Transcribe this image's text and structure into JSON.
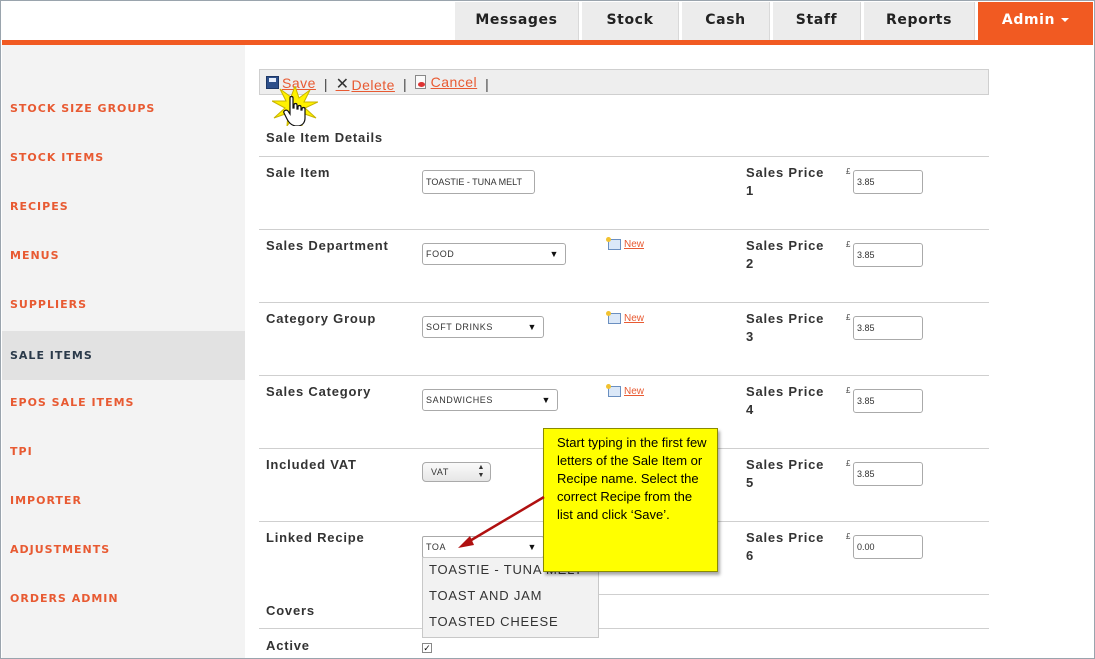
{
  "nav": {
    "tabs": [
      {
        "label": "Messages"
      },
      {
        "label": "Stock"
      },
      {
        "label": "Cash"
      },
      {
        "label": "Staff"
      },
      {
        "label": "Reports"
      },
      {
        "label": "Admin"
      }
    ],
    "active_color": "#f15a22"
  },
  "sidebar": {
    "items": [
      {
        "label": "STOCK SIZE GROUPS"
      },
      {
        "label": "STOCK ITEMS"
      },
      {
        "label": "RECIPES"
      },
      {
        "label": "MENUS"
      },
      {
        "label": "SUPPLIERS"
      },
      {
        "label": "SALE ITEMS"
      },
      {
        "label": "EPOS SALE ITEMS"
      },
      {
        "label": "TPI"
      },
      {
        "label": "IMPORTER"
      },
      {
        "label": "ADJUSTMENTS"
      },
      {
        "label": "ORDERS ADMIN"
      }
    ],
    "active_item": "SALE ITEMS"
  },
  "toolbar": {
    "save_label": "Save",
    "delete_label": "Delete",
    "cancel_label": "Cancel",
    "separator": "|"
  },
  "form": {
    "section_title": "Sale Item Details",
    "sale_item": {
      "label": "Sale Item",
      "value": "TOASTIE - TUNA MELT"
    },
    "sales_department": {
      "label": "Sales Department",
      "value": "FOOD",
      "new_label": "New"
    },
    "category_group": {
      "label": "Category Group",
      "value": "SOFT DRINKS",
      "new_label": "New"
    },
    "sales_category": {
      "label": "Sales Category",
      "value": "SANDWICHES",
      "new_label": "New"
    },
    "included_vat": {
      "label": "Included VAT",
      "value": "VAT"
    },
    "linked_recipe": {
      "label": "Linked Recipe",
      "value": "TOA",
      "options": [
        "TOASTIE - TUNA MELT",
        "TOAST AND JAM",
        "TOASTED CHEESE"
      ]
    },
    "covers": {
      "label": "Covers"
    },
    "active": {
      "label": "Active",
      "checked": true,
      "check_mark": "✓"
    },
    "currency_symbol": "£",
    "prices": [
      {
        "label": "Sales Price 1",
        "value": "3.85"
      },
      {
        "label": "Sales Price 2",
        "value": "3.85"
      },
      {
        "label": "Sales Price 3",
        "value": "3.85"
      },
      {
        "label": "Sales Price 4",
        "value": "3.85"
      },
      {
        "label": "Sales Price 5",
        "value": "3.85"
      },
      {
        "label": "Sales Price 6",
        "value": "0.00"
      }
    ]
  },
  "callout": {
    "text": "Start typing in the first few letters of the Sale Item or Recipe name. Select the correct Recipe from the list and click ‘Save’.",
    "color": "#ffff00"
  }
}
